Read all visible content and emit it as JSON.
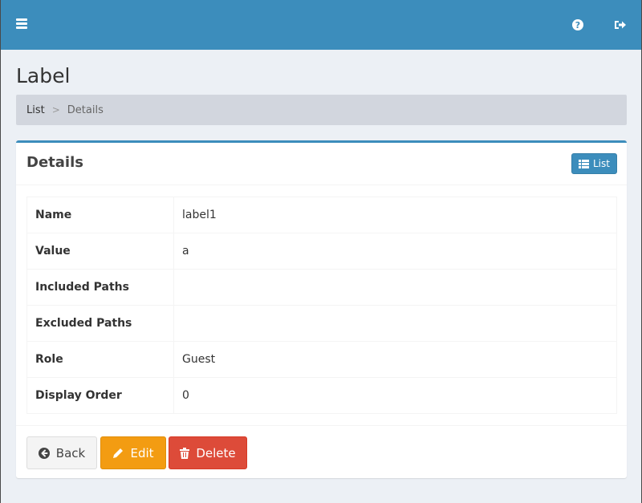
{
  "header": {
    "menu_icon": "hamburger-icon",
    "help_icon": "question-circle-icon",
    "logout_icon": "sign-out-icon",
    "bar_color": "#3c8dbc"
  },
  "page": {
    "title": "Label"
  },
  "breadcrumb": {
    "items": [
      {
        "label": "List",
        "link": true
      },
      {
        "label": "Details",
        "link": false
      }
    ],
    "separator": ">"
  },
  "box": {
    "title": "Details",
    "list_button_label": "List",
    "list_button_icon": "th-list-icon"
  },
  "details": [
    {
      "label": "Name",
      "value": "label1"
    },
    {
      "label": "Value",
      "value": "a"
    },
    {
      "label": "Included Paths",
      "value": ""
    },
    {
      "label": "Excluded Paths",
      "value": ""
    },
    {
      "label": "Role",
      "value": "Guest"
    },
    {
      "label": "Display Order",
      "value": "0"
    }
  ],
  "actions": {
    "back_label": "Back",
    "edit_label": "Edit",
    "delete_label": "Delete",
    "colors": {
      "back": "#f4f4f4",
      "edit": "#f39c12",
      "delete": "#dd4b39"
    }
  }
}
